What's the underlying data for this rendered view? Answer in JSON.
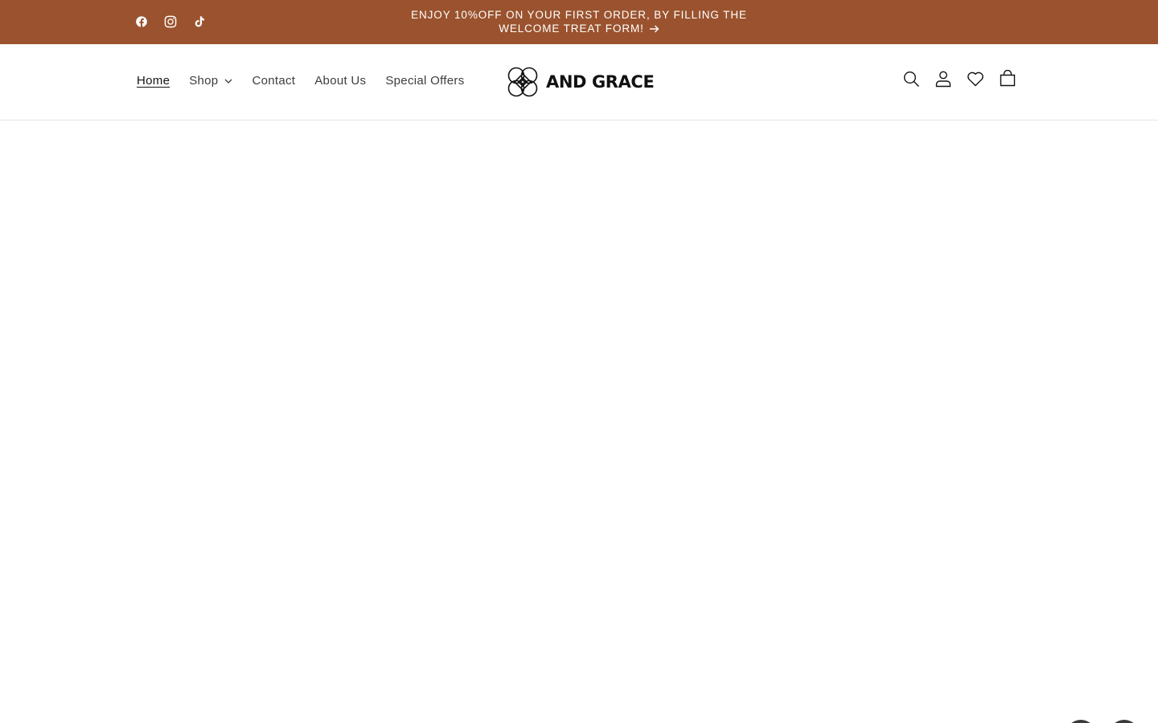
{
  "announcement": {
    "text": "ENJOY 10%OFF ON YOUR FIRST ORDER, BY FILLING THE WELCOME TREAT FORM!",
    "background": "#9a532e",
    "social_icons": [
      "facebook-icon",
      "instagram-icon",
      "tiktok-icon"
    ]
  },
  "header": {
    "nav": [
      {
        "label": "Home",
        "active": true
      },
      {
        "label": "Shop",
        "has_dropdown": true
      },
      {
        "label": "Contact"
      },
      {
        "label": "About Us"
      },
      {
        "label": "Special Offers"
      }
    ],
    "logo_text": "AND GRACE",
    "icons": [
      "search-icon",
      "account-icon",
      "wishlist-heart-icon",
      "cart-icon"
    ]
  }
}
